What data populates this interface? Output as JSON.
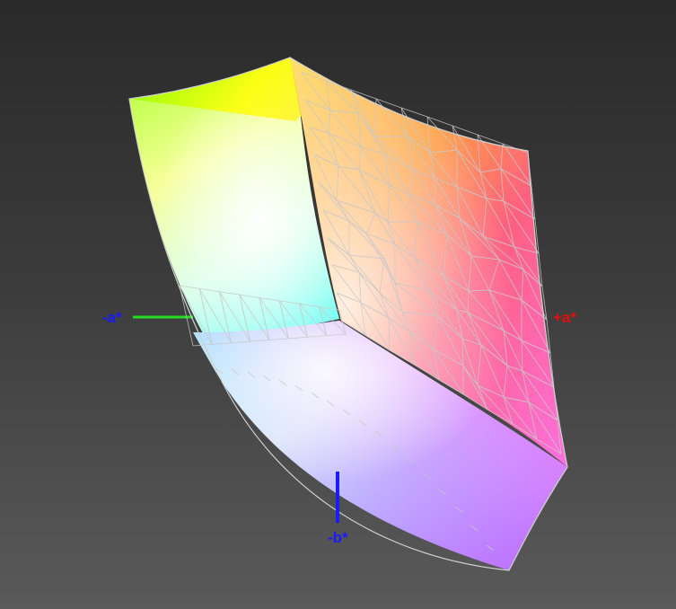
{
  "axes": {
    "neg_a": {
      "label": "-a*",
      "color": "#1a1aff"
    },
    "pos_a": {
      "label": "+a*",
      "color": "#e01010"
    },
    "neg_b": {
      "label": "-b*",
      "color": "#1a1aff"
    },
    "axis_line_colors": {
      "neg_a": "#22dd22",
      "pos_a": "#e01010",
      "neg_b": "#1a1aff"
    }
  },
  "gamut": {
    "corner_colors": {
      "green": "#7fff00",
      "yellow": "#ffff00",
      "orange_red": "#ff4a10",
      "magenta": "#ff50ff",
      "violet": "#a040ff",
      "blue": "#7080ff",
      "cyan": "#60ffff",
      "white": "#ffffff"
    },
    "wireframe_color": "#c8c8c8"
  }
}
